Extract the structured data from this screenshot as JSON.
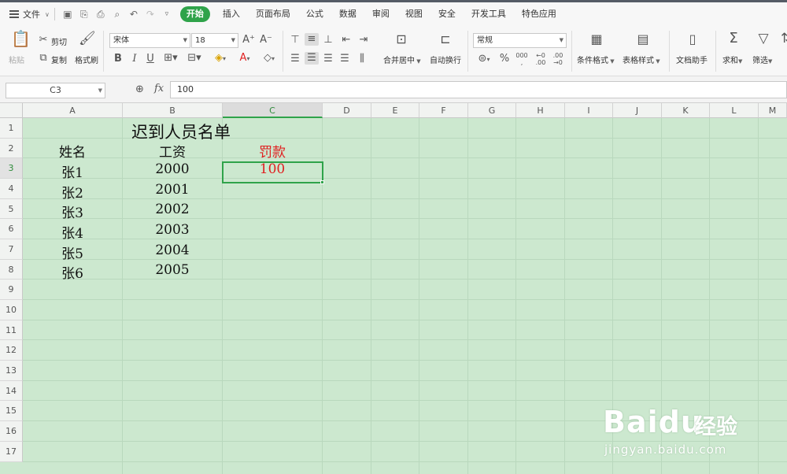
{
  "menu": {
    "file_label": "文件",
    "tabs": [
      "开始",
      "插入",
      "页面布局",
      "公式",
      "数据",
      "审阅",
      "视图",
      "安全",
      "开发工具",
      "特色应用"
    ]
  },
  "ribbon": {
    "paste": "粘贴",
    "cut": "剪切",
    "copy": "复制",
    "format_painter": "格式刷",
    "font_name": "宋体",
    "font_size": "18",
    "merge_center": "合并居中",
    "auto_wrap": "自动换行",
    "number_format": "常规",
    "conditional_format": "条件格式",
    "table_style": "表格样式",
    "doc_assistant": "文档助手",
    "sum": "求和",
    "filter": "筛选"
  },
  "formula_bar": {
    "name_box": "C3",
    "fx": "fx",
    "value": "100"
  },
  "sheet": {
    "columns": [
      "A",
      "B",
      "C",
      "D",
      "E",
      "F",
      "G",
      "H",
      "I",
      "J",
      "K",
      "L",
      "M"
    ],
    "rows": [
      "1",
      "2",
      "3",
      "4",
      "5",
      "6",
      "7",
      "8",
      "9",
      "10",
      "11",
      "12",
      "13",
      "14",
      "15",
      "16",
      "17"
    ],
    "title": "迟到人员名单",
    "headers": {
      "name": "姓名",
      "salary": "工资",
      "fine": "罚款"
    },
    "records": [
      {
        "name": "张1",
        "salary": "2000",
        "fine": "100"
      },
      {
        "name": "张2",
        "salary": "2001"
      },
      {
        "name": "张3",
        "salary": "2002"
      },
      {
        "name": "张4",
        "salary": "2003"
      },
      {
        "name": "张5",
        "salary": "2004"
      },
      {
        "name": "张6",
        "salary": "2005"
      }
    ],
    "selected_cell": "C3"
  },
  "watermark": {
    "brand": "Baidu",
    "suffix": "经验",
    "url": "jingyan.baidu.com"
  },
  "colors": {
    "accent": "#2fa34a",
    "sheet_bg": "#cce8cf",
    "fine_text": "#e02020"
  }
}
